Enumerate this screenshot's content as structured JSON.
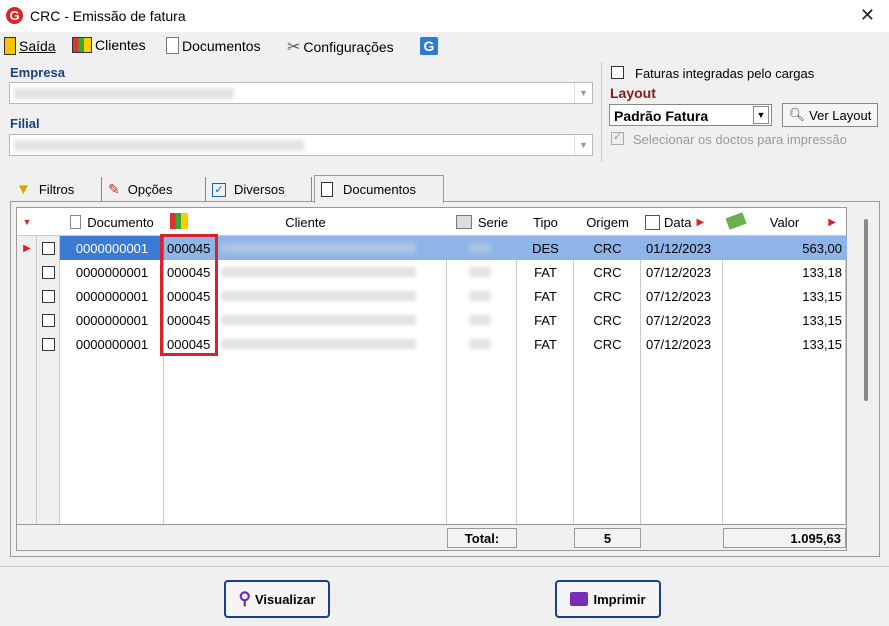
{
  "window": {
    "title": "CRC - Emissão de fatura",
    "logo": "G"
  },
  "menu": [
    {
      "label": "Saída",
      "icon": "exit-door-icon"
    },
    {
      "label": "Clientes",
      "icon": "clients-icon"
    },
    {
      "label": "Documentos",
      "icon": "document-icon"
    },
    {
      "label": "Configurações",
      "icon": "tools-icon"
    }
  ],
  "filters": {
    "empresa_label": "Empresa",
    "filial_label": "Filial",
    "faturas_integradas_label": "Faturas integradas pelo cargas",
    "layout_label": "Layout",
    "layout_value": "Padrão Fatura",
    "ver_layout_label": "Ver Layout",
    "selecionar_label": "Selecionar os doctos para impressão"
  },
  "tabs": [
    "Filtros",
    "Opções",
    "Diversos",
    "Documentos"
  ],
  "grid": {
    "headers": {
      "documento": "Documento",
      "cliente": "Cliente",
      "serie": "Serie",
      "tipo": "Tipo",
      "origem": "Origem",
      "data": "Data",
      "valor": "Valor"
    },
    "rows": [
      {
        "documento": "0000000001",
        "cliente": "000045",
        "tipo": "DES",
        "origem": "CRC",
        "data": "01/12/2023",
        "valor": "563,00"
      },
      {
        "documento": "0000000001",
        "cliente": "000045",
        "tipo": "FAT",
        "origem": "CRC",
        "data": "07/12/2023",
        "valor": "133,18"
      },
      {
        "documento": "0000000001",
        "cliente": "000045",
        "tipo": "FAT",
        "origem": "CRC",
        "data": "07/12/2023",
        "valor": "133,15"
      },
      {
        "documento": "0000000001",
        "cliente": "000045",
        "tipo": "FAT",
        "origem": "CRC",
        "data": "07/12/2023",
        "valor": "133,15"
      },
      {
        "documento": "0000000001",
        "cliente": "000045",
        "tipo": "FAT",
        "origem": "CRC",
        "data": "07/12/2023",
        "valor": "133,15"
      }
    ],
    "footer": {
      "total_label": "Total:",
      "count": "5",
      "sum": "1.095,63"
    }
  },
  "buttons": {
    "visualizar": "Visualizar",
    "imprimir": "Imprimir"
  },
  "colors": {
    "accent": "#1a3f8a",
    "selection": "#3a7bd5",
    "highlight": "#d8232a"
  }
}
